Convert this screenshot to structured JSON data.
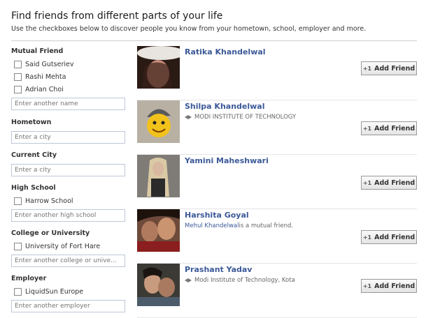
{
  "header": {
    "title": "Find friends from different parts of your life",
    "subtitle": "Use the checkboxes below to discover people you know from your hometown, school, employer and more."
  },
  "sidebar": {
    "mutual_friend": {
      "label": "Mutual Friend",
      "options": [
        "Said Gutseriev",
        "Rashi Mehta",
        "Adrian Choi"
      ],
      "placeholder": "Enter another name"
    },
    "hometown": {
      "label": "Hometown",
      "placeholder": "Enter a city"
    },
    "current_city": {
      "label": "Current City",
      "placeholder": "Enter a city"
    },
    "high_school": {
      "label": "High School",
      "options": [
        "Harrow School"
      ],
      "placeholder": "Enter another high school"
    },
    "college": {
      "label": "College or University",
      "options": [
        "University of Fort Hare"
      ],
      "placeholder": "Enter another college or unive..."
    },
    "employer": {
      "label": "Employer",
      "options": [
        "LiquidSun Europe"
      ],
      "placeholder": "Enter another employer"
    }
  },
  "results": [
    {
      "name": "Ratika Khandelwal",
      "detail": "",
      "button": "Add Friend"
    },
    {
      "name": "Shilpa Khandelwal",
      "detail": "MODI INSTITUTE OF TECHNOLOGY",
      "button": "Add Friend"
    },
    {
      "name": "Yamini Maheshwari",
      "detail": "",
      "button": "Add Friend"
    },
    {
      "name": "Harshita Goyal",
      "mutual_link": "Mehul Khandelwal",
      "mutual_text": " is a mutual friend.",
      "button": "Add Friend"
    },
    {
      "name": "Prashant Yadav",
      "detail": "Modi Institute of Technology, Kota",
      "button": "Add Friend"
    }
  ]
}
